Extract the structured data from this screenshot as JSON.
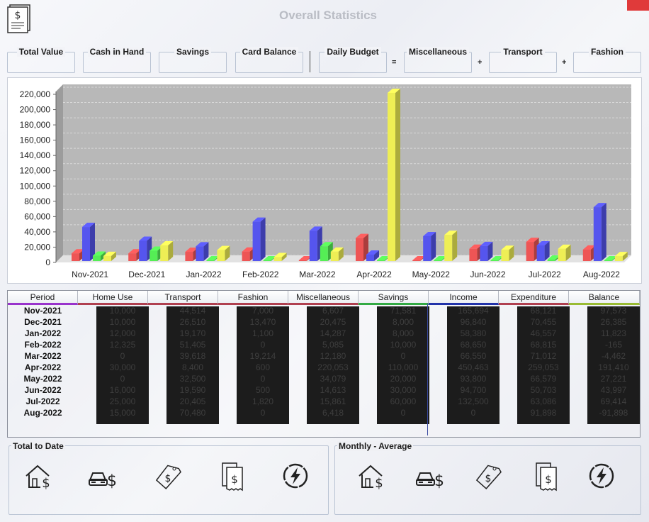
{
  "window": {
    "title": "Overall Statistics",
    "close_color": "#e03a3a"
  },
  "icons": {
    "app": "document-dollar-icon",
    "home": "house-dollar-icon",
    "transport": "car-dollar-icon",
    "fashion": "price-tag-dollar-icon",
    "misc": "receipt-dollar-icon",
    "utility": "lightning-icon"
  },
  "summary_fields": [
    {
      "label": "Total Value",
      "value": ""
    },
    {
      "label": "Cash in Hand",
      "value": ""
    },
    {
      "label": "Savings",
      "value": ""
    },
    {
      "label": "Card Balance",
      "value": ""
    },
    {
      "label": "Daily Budget",
      "value": ""
    },
    {
      "label": "Miscellaneous",
      "value": ""
    },
    {
      "label": "Transport",
      "value": ""
    },
    {
      "label": "Fashion",
      "value": ""
    }
  ],
  "operators": {
    "equals": "=",
    "plus1": "+",
    "plus2": "+"
  },
  "chart_data": {
    "type": "bar",
    "categories": [
      "Nov-2021",
      "Dec-2021",
      "Jan-2022",
      "Feb-2022",
      "Mar-2022",
      "Apr-2022",
      "May-2022",
      "Jun-2022",
      "Jul-2022",
      "Aug-2022"
    ],
    "series": [
      {
        "color": "#ee5555",
        "values": [
          10000,
          10000,
          12000,
          12325,
          0,
          30000,
          0,
          16000,
          25000,
          15000
        ]
      },
      {
        "color": "#5555ee",
        "values": [
          44514,
          26510,
          19170,
          51405,
          39618,
          8400,
          32500,
          19590,
          20405,
          70480
        ]
      },
      {
        "color": "#55ee55",
        "values": [
          7000,
          13470,
          1100,
          0,
          19214,
          600,
          0,
          500,
          1820,
          0
        ]
      },
      {
        "color": "#eeee55",
        "values": [
          6607,
          20475,
          14287,
          5085,
          12180,
          220053,
          34079,
          14613,
          15861,
          6418
        ]
      }
    ],
    "ylim": [
      0,
      220000
    ],
    "yticks": [
      "0",
      "20,000",
      "40,000",
      "60,000",
      "80,000",
      "100,000",
      "120,000",
      "140,000",
      "160,000",
      "180,000",
      "200,000",
      "220,000"
    ],
    "grid": true,
    "title": "",
    "xlabel": "",
    "ylabel": ""
  },
  "table": {
    "headers": [
      "Period",
      "Home Use",
      "Transport",
      "Fashion",
      "Miscellaneous",
      "Savings",
      "Income",
      "Expenditure",
      "Balance"
    ],
    "header_colors": [
      "#9933cc",
      "#b04050",
      "#b04050",
      "#b04050",
      "#b04050",
      "#33aa44",
      "#2233aa",
      "#b04050",
      "#99bb33"
    ],
    "rows": [
      [
        "Nov-2021",
        "10,000",
        "44,514",
        "7,000",
        "6,607",
        "71,581",
        "165,694",
        "68,121",
        "97,573"
      ],
      [
        "Dec-2021",
        "10,000",
        "26,510",
        "13,470",
        "20,475",
        "8,000",
        "96,840",
        "70,455",
        "26,385"
      ],
      [
        "Jan-2022",
        "12,000",
        "19,170",
        "1,100",
        "14,287",
        "8,000",
        "58,380",
        "46,557",
        "11,823"
      ],
      [
        "Feb-2022",
        "12,325",
        "51,405",
        "0",
        "5,085",
        "10,000",
        "68,650",
        "68,815",
        "-165"
      ],
      [
        "Mar-2022",
        "0",
        "39,618",
        "19,214",
        "12,180",
        "0",
        "66,550",
        "71,012",
        "-4,462"
      ],
      [
        "Apr-2022",
        "30,000",
        "8,400",
        "600",
        "220,053",
        "110,000",
        "450,463",
        "259,053",
        "191,410"
      ],
      [
        "May-2022",
        "0",
        "32,500",
        "0",
        "34,079",
        "20,000",
        "93,800",
        "66,579",
        "27,221"
      ],
      [
        "Jun-2022",
        "16,000",
        "19,590",
        "500",
        "14,613",
        "30,000",
        "94,700",
        "50,703",
        "43,997"
      ],
      [
        "Jul-2022",
        "25,000",
        "20,405",
        "1,820",
        "15,861",
        "60,000",
        "132,500",
        "63,086",
        "69,414"
      ],
      [
        "Aug-2022",
        "15,000",
        "70,480",
        "0",
        "6,418",
        "0",
        "0",
        "91,898",
        "-91,898"
      ]
    ]
  },
  "groups": {
    "total": "Total to Date",
    "monthly": "Monthly - Average"
  }
}
